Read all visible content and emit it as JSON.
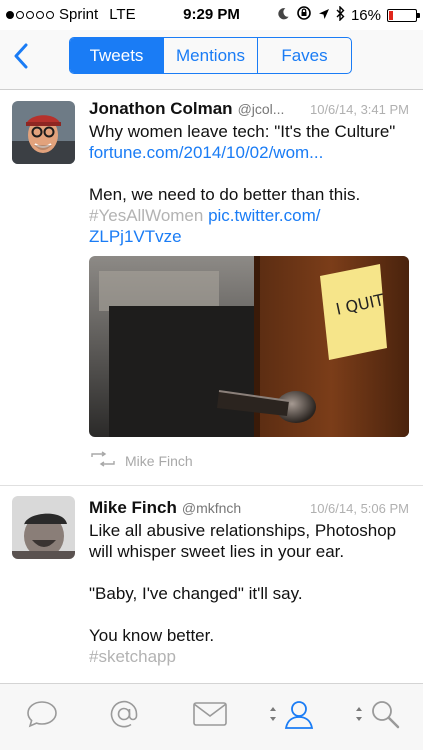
{
  "status_bar": {
    "carrier": "Sprint",
    "network": "LTE",
    "time": "9:29 PM",
    "battery": "16%",
    "battery_level": 0.16,
    "battery_color": "#e0261b",
    "signal_bars_filled": 1,
    "signal_bars_total": 5,
    "icons": [
      "moon-icon",
      "rotation-lock-icon",
      "location-arrow-icon",
      "bluetooth-icon",
      "battery-icon"
    ]
  },
  "nav": {
    "back_icon": "chevron-left-icon",
    "tabs": [
      {
        "label": "Tweets",
        "active": true
      },
      {
        "label": "Mentions",
        "active": false
      },
      {
        "label": "Faves",
        "active": false
      }
    ],
    "accent_color": "#1a7cf5"
  },
  "tweets": [
    {
      "author": "Jonathon Colman",
      "handle": "@jcol...",
      "timestamp": "10/6/14, 3:41 PM",
      "line1": "Why women leave tech: \"It's the Culture\"",
      "link1": "fortune.com/2014/10/02/wom...",
      "line2": "Men, we need to do better than this.",
      "hashtag": "#YesAllWomen",
      "link2a": "pic.twitter.com/",
      "link2b": "ZLPj1VTvze",
      "note_text": "I QUIT",
      "retweeted_by": "Mike Finch"
    },
    {
      "author": "Mike Finch",
      "handle": "@mkfnch",
      "timestamp": "10/6/14, 5:06 PM",
      "line1": "Like all abusive relationships, Photoshop",
      "line2": "will whisper sweet lies in your ear.",
      "line3": "\"Baby, I've changed\" it'll say.",
      "line4": "You know better.",
      "hashtag": "#sketchapp"
    }
  ],
  "tab_bar": {
    "items": [
      "speech-bubble-icon",
      "at-sign-icon",
      "envelope-icon",
      "profile-icon",
      "search-icon"
    ],
    "active": "profile-icon",
    "inactive_color": "#9a9a9a"
  }
}
